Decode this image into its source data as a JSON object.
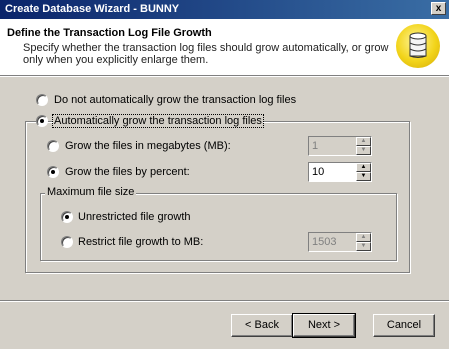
{
  "window": {
    "title": "Create Database Wizard - BUNNY",
    "close_glyph": "x"
  },
  "header": {
    "title": "Define the Transaction Log File Growth",
    "description": "Specify whether the transaction log files should grow automatically, or grow only when you explicitly enlarge them."
  },
  "growth_options": {
    "no_grow_label": "Do not automatically grow the transaction log files",
    "auto_grow_label": "Automatically grow the transaction log files",
    "selected": "auto_grow"
  },
  "grow_by": {
    "megabytes_label": "Grow the files in megabytes (MB):",
    "megabytes_value": "1",
    "percent_label": "Grow the files by percent:",
    "percent_value": "10",
    "selected": "percent"
  },
  "max_size": {
    "caption": "Maximum file size",
    "unrestricted_label": "Unrestricted file growth",
    "restrict_label": "Restrict file growth to MB:",
    "restrict_value": "1503",
    "selected": "unrestricted"
  },
  "buttons": {
    "back": "< Back",
    "next": "Next >",
    "cancel": "Cancel"
  },
  "icons": {
    "wizard": "database-icon",
    "spin_up": "spin-up-arrow",
    "spin_down": "spin-down-arrow"
  }
}
